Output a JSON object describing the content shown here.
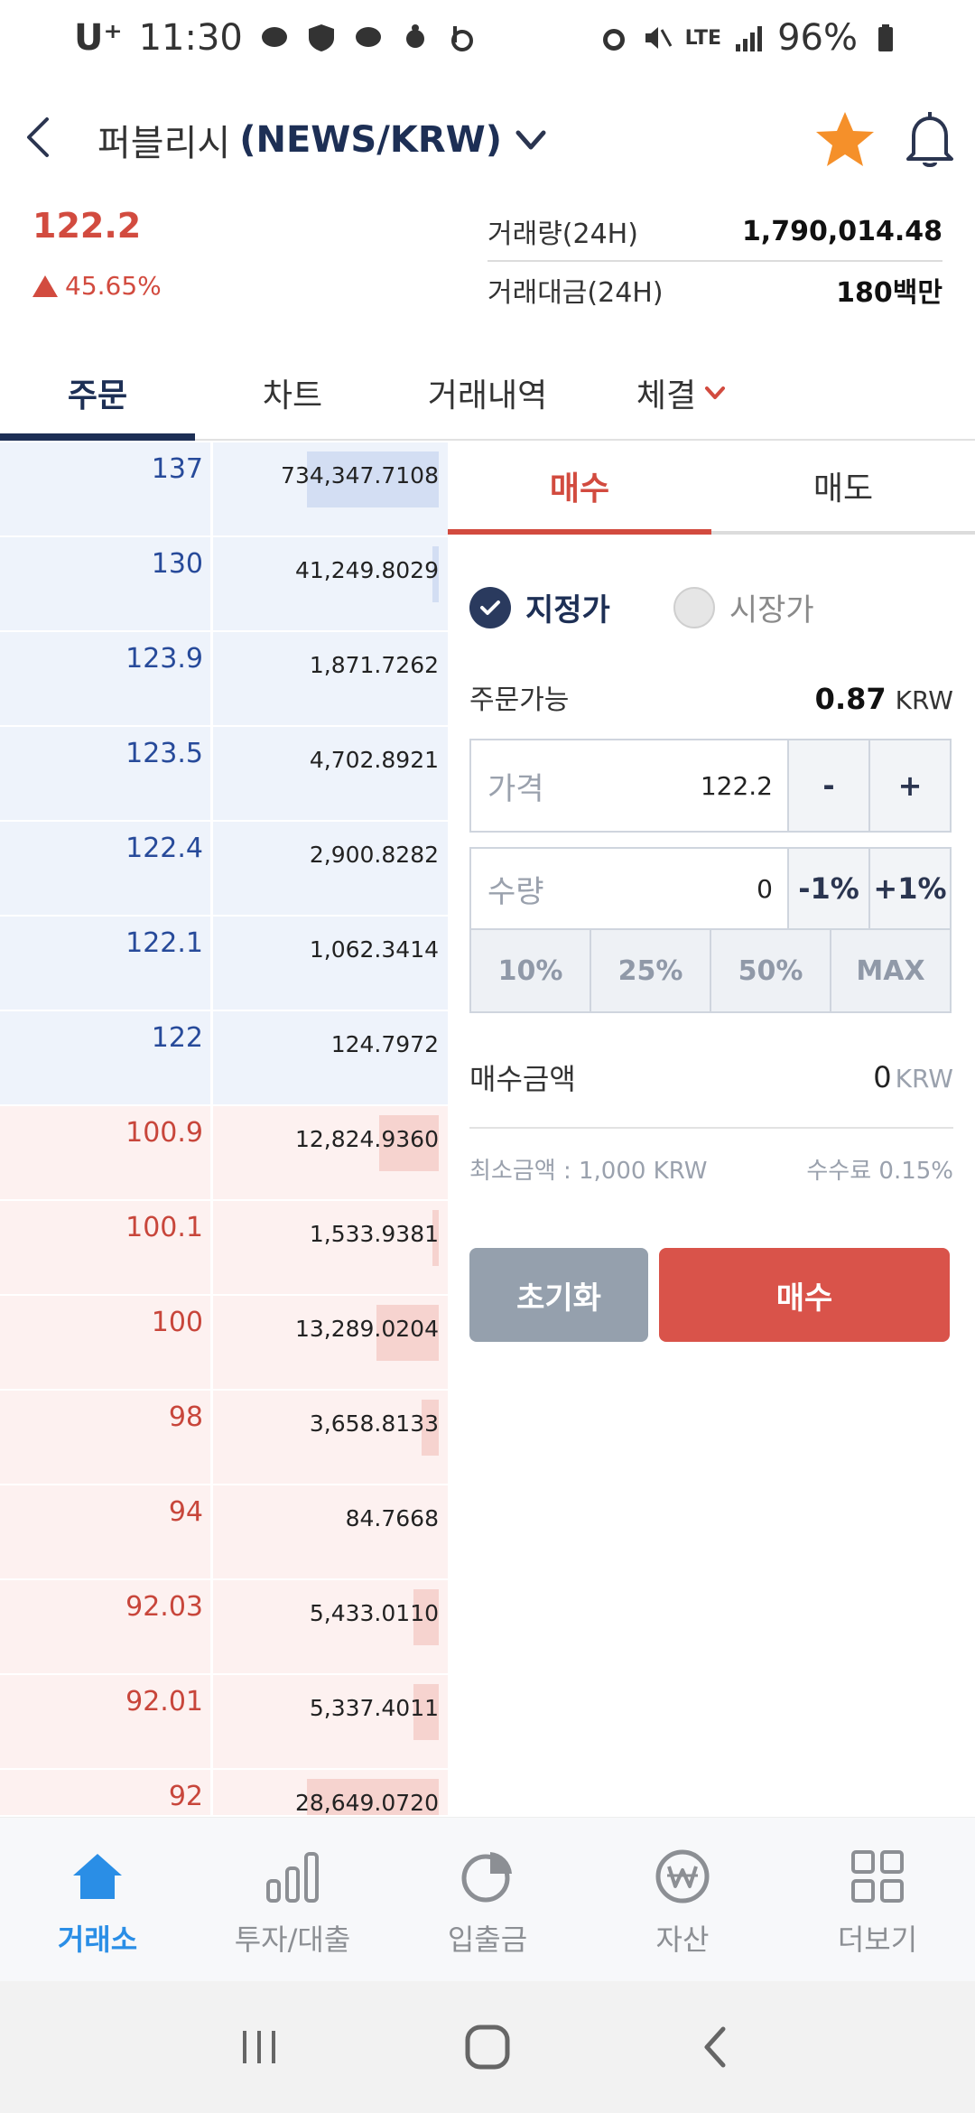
{
  "status_bar": {
    "carrier": "U⁺",
    "time": "11:30",
    "battery": "96%",
    "network": "LTE"
  },
  "header": {
    "pair_name": "퍼블리시",
    "pair_symbol": "(NEWS/KRW)"
  },
  "summary": {
    "price": "122.2",
    "change": "45.65%",
    "volume_label": "거래량(24H)",
    "volume_value": "1,790,014.48",
    "turnover_label": "거래대금(24H)",
    "turnover_value": "180백만"
  },
  "main_tabs": [
    {
      "label": "주문"
    },
    {
      "label": "차트"
    },
    {
      "label": "거래내역"
    },
    {
      "label": "체결"
    }
  ],
  "orderbook": {
    "asks": [
      {
        "price": "137",
        "qty": "734,347.7108",
        "depth": 1.0
      },
      {
        "price": "130",
        "qty": "41,249.8029",
        "depth": 0.05
      },
      {
        "price": "123.9",
        "qty": "1,871.7262",
        "depth": 0.0
      },
      {
        "price": "123.5",
        "qty": "4,702.8921",
        "depth": 0.0
      },
      {
        "price": "122.4",
        "qty": "2,900.8282",
        "depth": 0.0
      },
      {
        "price": "122.1",
        "qty": "1,062.3414",
        "depth": 0.0
      },
      {
        "price": "122",
        "qty": "124.7972",
        "depth": 0.0
      }
    ],
    "bids": [
      {
        "price": "100.9",
        "qty": "12,824.9360",
        "depth": 0.45
      },
      {
        "price": "100.1",
        "qty": "1,533.9381",
        "depth": 0.05
      },
      {
        "price": "100",
        "qty": "13,289.0204",
        "depth": 0.47
      },
      {
        "price": "98",
        "qty": "3,658.8133",
        "depth": 0.13
      },
      {
        "price": "94",
        "qty": "84.7668",
        "depth": 0.0
      },
      {
        "price": "92.03",
        "qty": "5,433.0110",
        "depth": 0.19
      },
      {
        "price": "92.01",
        "qty": "5,337.4011",
        "depth": 0.19
      },
      {
        "price": "92",
        "qty": "28,649.0720",
        "depth": 1.0
      }
    ]
  },
  "order_panel": {
    "buy_tab": "매수",
    "sell_tab": "매도",
    "limit_label": "지정가",
    "market_label": "시장가",
    "available_label": "주문가능",
    "available_value": "0.87",
    "available_unit": "KRW",
    "price_label": "가격",
    "price_value": "122.2",
    "minus": "-",
    "plus": "+",
    "qty_label": "수량",
    "qty_value": "0",
    "minus_pct": "-1%",
    "plus_pct": "+1%",
    "pct_options": [
      "10%",
      "25%",
      "50%",
      "MAX"
    ],
    "total_label": "매수금액",
    "total_value": "0",
    "total_unit": "KRW",
    "min_amount": "최소금액 : 1,000 KRW",
    "fee": "수수료 0.15%",
    "reset_button": "초기화",
    "buy_button": "매수"
  },
  "bottom_nav": [
    {
      "label": "거래소",
      "icon": "home-icon"
    },
    {
      "label": "투자/대출",
      "icon": "bar-chart-icon"
    },
    {
      "label": "입출금",
      "icon": "pie-chart-icon"
    },
    {
      "label": "자산",
      "icon": "won-coin-icon"
    },
    {
      "label": "더보기",
      "icon": "grid-icon"
    }
  ],
  "colors": {
    "accent_red": "#d24b3f",
    "navy": "#1d2f55",
    "nav_active": "#2a8ee6"
  }
}
